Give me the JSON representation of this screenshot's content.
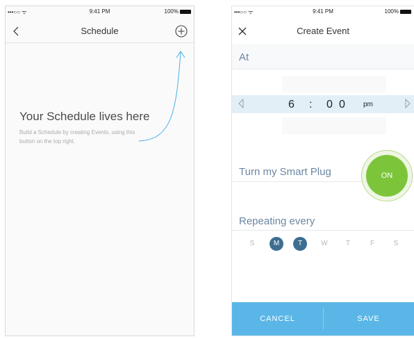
{
  "screen1": {
    "status": {
      "signal": "•••○○ ᯤ",
      "time": "9:41 PM",
      "battery": "100%"
    },
    "nav": {
      "title": "Schedule",
      "back_icon": "chevron-left-icon",
      "add_icon": "plus-circle-icon"
    },
    "empty_state": {
      "title": "Your Schedule lives here",
      "description": "Build a Schedule by creating Events, using this button on the top right."
    }
  },
  "screen2": {
    "status": {
      "signal": "•••○○ ᯤ",
      "time": "9:41 PM",
      "battery": "100%"
    },
    "nav": {
      "title": "Create Event",
      "close_icon": "close-icon"
    },
    "at_label": "At",
    "time_picker": {
      "hour": "6",
      "separator": ":",
      "minute_tens": "0",
      "minute_ones": "0",
      "period": "pm"
    },
    "plug": {
      "label": "Turn my Smart Plug",
      "toggle": "ON"
    },
    "repeat": {
      "label": "Repeating every",
      "days": [
        {
          "label": "S",
          "selected": false
        },
        {
          "label": "M",
          "selected": true
        },
        {
          "label": "T",
          "selected": true
        },
        {
          "label": "W",
          "selected": false
        },
        {
          "label": "T",
          "selected": false
        },
        {
          "label": "F",
          "selected": false
        },
        {
          "label": "S",
          "selected": false
        }
      ]
    },
    "footer": {
      "cancel": "CANCEL",
      "save": "SAVE"
    }
  },
  "colors": {
    "accent_blue": "#5ab6e6",
    "label_blue": "#6b87a3",
    "selected_day": "#3d6e91",
    "on_green": "#7cc53b",
    "picker_band": "#e3eff6",
    "hint_arrow": "#45b0e5"
  }
}
